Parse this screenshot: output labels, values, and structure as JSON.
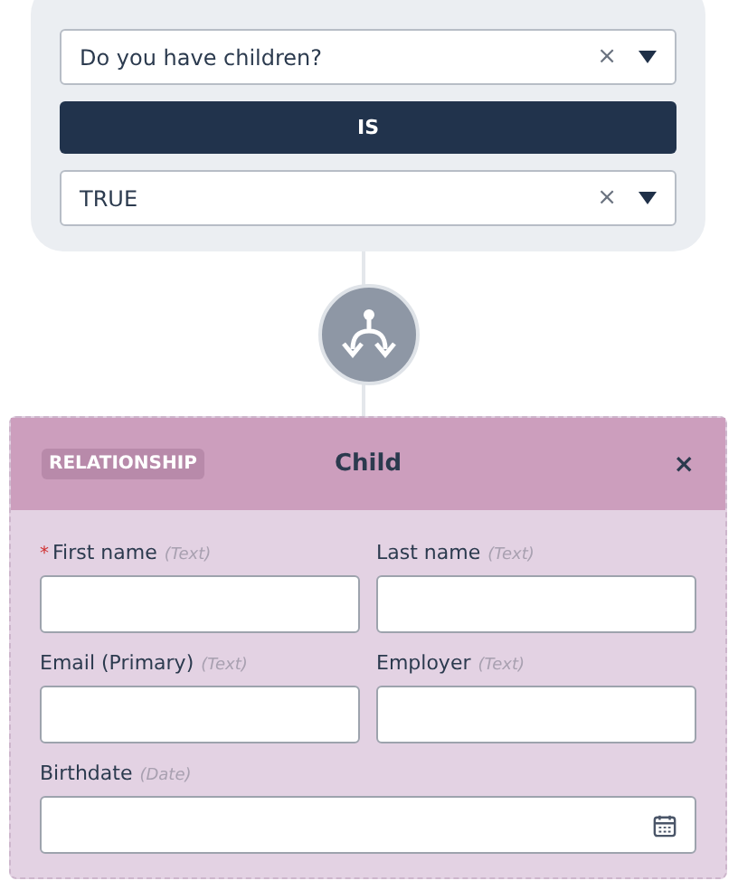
{
  "condition": {
    "question": {
      "value": "Do you have children?",
      "clear": "×"
    },
    "operator": "IS",
    "answer": {
      "value": "TRUE",
      "clear": "×"
    }
  },
  "relationship_card": {
    "badge": "RELATIONSHIP",
    "title": "Child",
    "close": "×",
    "required_marker": "*",
    "fields": [
      {
        "label": "First name",
        "type_hint": "(Text)",
        "required": true,
        "kind": "text"
      },
      {
        "label": "Last name",
        "type_hint": "(Text)",
        "required": false,
        "kind": "text"
      },
      {
        "label": "Email (Primary)",
        "type_hint": "(Text)",
        "required": false,
        "kind": "text"
      },
      {
        "label": "Employer",
        "type_hint": "(Text)",
        "required": false,
        "kind": "text"
      },
      {
        "label": "Birthdate",
        "type_hint": "(Date)",
        "required": false,
        "kind": "date"
      }
    ]
  }
}
